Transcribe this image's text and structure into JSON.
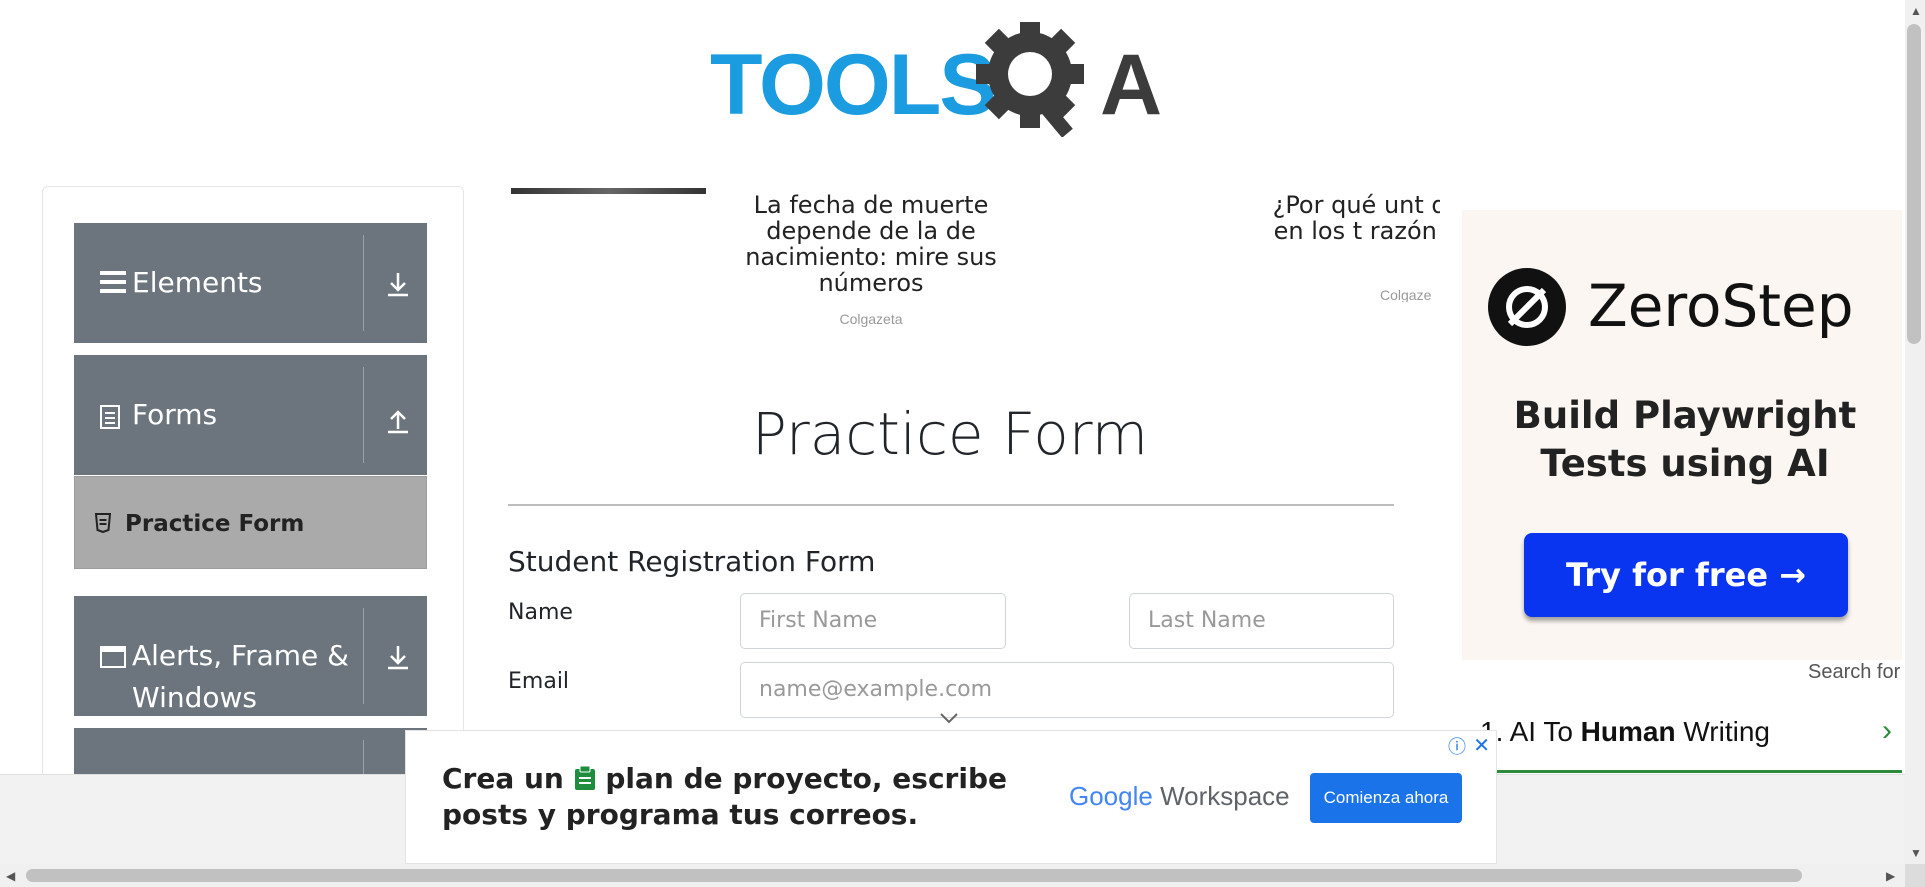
{
  "logo": {
    "text": "TOOLS",
    "letter": "A"
  },
  "sidebar": {
    "groups": [
      {
        "label": "Elements",
        "icon": "hamburger-icon",
        "arrow": "download-arrow-icon"
      },
      {
        "label": "Forms",
        "icon": "document-icon",
        "arrow": "upload-arrow-icon"
      },
      {
        "label": "Alerts, Frame &",
        "label2": "Windows",
        "icon": "window-icon",
        "arrow": "download-arrow-icon"
      }
    ],
    "active_item": "Practice Form"
  },
  "carousel": [
    {
      "title": "La fecha de muerte depende de la de nacimiento: mire sus números",
      "source": "Colgazeta"
    },
    {
      "title": "¿Por qué unt dental en los t razón te im",
      "source": "Colgaze"
    }
  ],
  "form": {
    "title": "Practice Form",
    "subtitle": "Student Registration Form",
    "name_label": "Name",
    "first_name_placeholder": "First Name",
    "last_name_placeholder": "Last Name",
    "email_label": "Email",
    "email_placeholder": "name@example.com"
  },
  "right_ad": {
    "brand": "ZeroStep",
    "tagline": "Build Playwright Tests using AI",
    "button": "Try for free →",
    "search_for": "Search for",
    "list_item_prefix": "1.  AI To ",
    "list_item_bold": "Human",
    "list_item_suffix": " Writing",
    "chevron": "›"
  },
  "bottom_ad": {
    "headline_1": "Crea un",
    "headline_1b": "plan de proyecto, escribe",
    "headline_2": "posts y programa tus correos.",
    "brand": "Google",
    "product": "Workspace",
    "cta": "Comienza ahora",
    "info": "ⓘ",
    "close": "✕"
  },
  "colors": {
    "brand_blue": "#1b9be0",
    "sidebar_gray": "#6c757d",
    "active_item": "#aaaaaa",
    "zerostep_button": "#0a35f0",
    "google_blue": "#1a73e8"
  }
}
